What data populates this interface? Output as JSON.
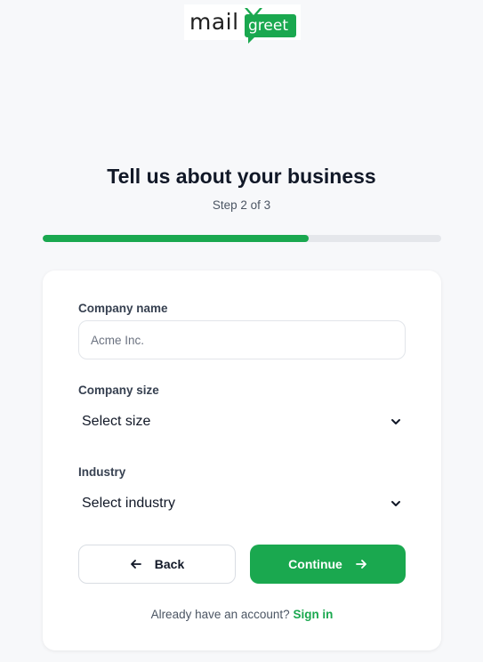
{
  "brand": {
    "mail": "mail",
    "greet": "greet",
    "accent": "#1aa84f"
  },
  "header": {
    "title": "Tell us about your business",
    "step": "Step 2 of 3"
  },
  "progress": {
    "fraction": 0.667
  },
  "form": {
    "company_name": {
      "label": "Company name",
      "placeholder": "Acme Inc.",
      "value": ""
    },
    "company_size": {
      "label": "Company size",
      "selected": "Select size"
    },
    "industry": {
      "label": "Industry",
      "selected": "Select industry"
    }
  },
  "buttons": {
    "back": "Back",
    "continue": "Continue"
  },
  "footer": {
    "prompt": "Already have an account?",
    "link": "Sign in"
  },
  "icons": {
    "back": "arrow-left-icon",
    "continue": "arrow-right-icon",
    "select": "chevron-down-icon"
  }
}
